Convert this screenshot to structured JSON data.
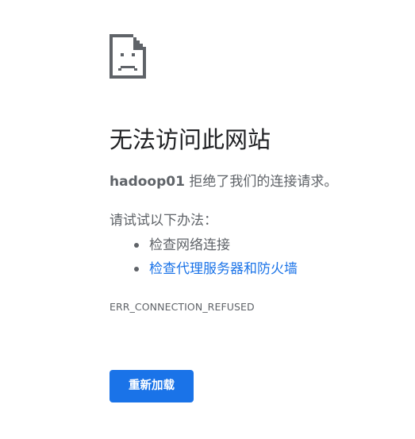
{
  "error_page": {
    "icon": "sad-page-icon",
    "title": "无法访问此网站",
    "summary": {
      "host": "hadoop01",
      "message": " 拒绝了我们的连接请求。"
    },
    "suggestions_label": "请试试以下办法：",
    "suggestions": [
      {
        "text": "检查网络连接",
        "is_link": false
      },
      {
        "text": "检查代理服务器和防火墙",
        "is_link": true
      }
    ],
    "error_code": "ERR_CONNECTION_REFUSED",
    "reload_label": "重新加载"
  },
  "colors": {
    "accent": "#1a73e8",
    "text_primary": "#202124",
    "text_secondary": "#5f6368",
    "background": "#ffffff"
  }
}
